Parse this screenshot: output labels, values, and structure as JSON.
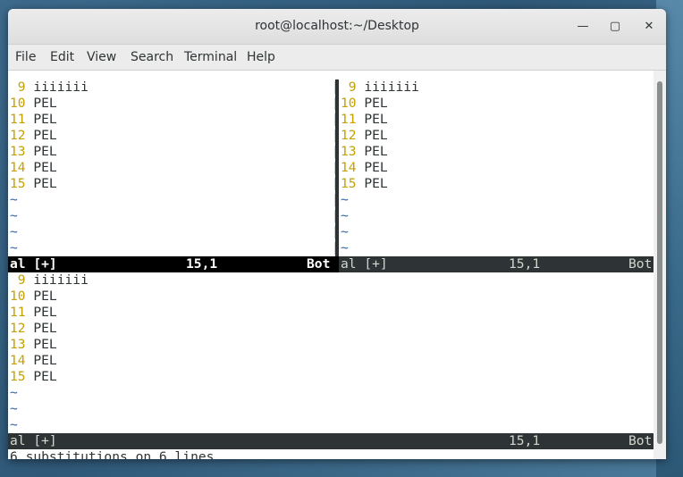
{
  "window": {
    "title": "root@localhost:~/Desktop",
    "minimize_glyph": "—",
    "maximize_glyph": "▢",
    "close_glyph": "✕"
  },
  "menu": [
    "File",
    "Edit",
    "View",
    "Search",
    "Terminal",
    "Help"
  ],
  "panes": {
    "top_left": {
      "lines": [
        {
          "num": " 9",
          "text": " iiiiiii"
        },
        {
          "num": "10",
          "text": " PEL"
        },
        {
          "num": "11",
          "text": " PEL"
        },
        {
          "num": "12",
          "text": " PEL"
        },
        {
          "num": "13",
          "text": " PEL"
        },
        {
          "num": "14",
          "text": " PEL"
        },
        {
          "num": "15",
          "text": " PEL"
        }
      ],
      "tildes": [
        "~",
        "~",
        "~",
        "~"
      ],
      "status": {
        "file": "al [+]",
        "pos": "15,1",
        "scroll": "Bot"
      }
    },
    "top_right": {
      "lines": [
        {
          "num": " 9",
          "text": " iiiiiii"
        },
        {
          "num": "10",
          "text": " PEL"
        },
        {
          "num": "11",
          "text": " PEL"
        },
        {
          "num": "12",
          "text": " PEL"
        },
        {
          "num": "13",
          "text": " PEL"
        },
        {
          "num": "14",
          "text": " PEL"
        },
        {
          "num": "15",
          "text": " PEL"
        }
      ],
      "tildes": [
        "~",
        "~",
        "~",
        "~"
      ],
      "status": {
        "file": "al [+]",
        "pos": "15,1",
        "scroll": "Bot"
      }
    },
    "bottom": {
      "lines": [
        {
          "num": " 9",
          "text": " iiiiiii"
        },
        {
          "num": "10",
          "text": " PEL"
        },
        {
          "num": "11",
          "text": " PEL"
        },
        {
          "num": "12",
          "text": " PEL"
        },
        {
          "num": "13",
          "text": " PEL"
        },
        {
          "num": "14",
          "text": " PEL"
        },
        {
          "num": "15",
          "text": " PEL"
        }
      ],
      "tildes": [
        "~",
        "~",
        "~"
      ],
      "status": {
        "file": "al [+]",
        "pos": "15,1",
        "scroll": "Bot"
      }
    }
  },
  "separator_char": "|",
  "command_line": "6 substitutions on 6 lines",
  "colors": {
    "line_number": "#c4a000",
    "tilde": "#3465a4",
    "status_active_bg": "#000000",
    "status_inactive_bg": "#2e3436"
  }
}
